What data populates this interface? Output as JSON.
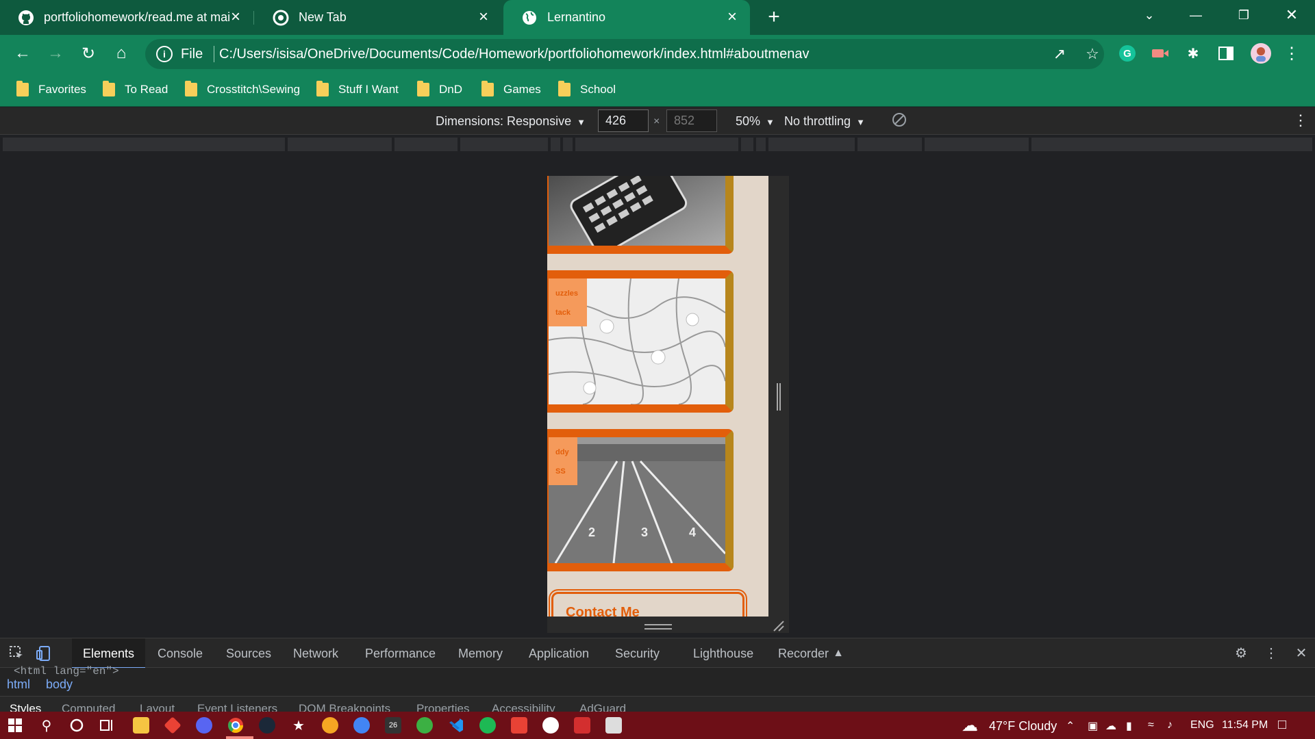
{
  "browser": {
    "tabs": [
      {
        "title": "portfoliohomework/read.me at mair",
        "icon": "github-icon"
      },
      {
        "title": "New Tab",
        "icon": "chrome-icon"
      },
      {
        "title": "Lernantino",
        "icon": "globe-icon",
        "active": true
      }
    ],
    "toolbar": {
      "scheme": "File",
      "url": "C:/Users/isisa/OneDrive/Documents/Code/Homework/portfoliohomework/index.html#aboutmenav"
    },
    "bookmarks": [
      "Favorites",
      "To Read",
      "Crosstitch\\Sewing",
      "Stuff I Want",
      "DnD",
      "Games",
      "School"
    ]
  },
  "device_toolbar": {
    "dimensions_label": "Dimensions: Responsive",
    "width": "426",
    "height": "852",
    "times": "×",
    "zoom": "50%",
    "throttling": "No throttling"
  },
  "page": {
    "cards": [
      {
        "name": "calculator",
        "tag_lines": []
      },
      {
        "name": "puzzles",
        "tag_lines": [
          "uzzles",
          "tack"
        ]
      },
      {
        "name": "track",
        "tag_lines": [
          "ddy",
          "SS"
        ]
      }
    ],
    "contact_heading": "Contact Me"
  },
  "devtools": {
    "tabs": [
      "Elements",
      "Console",
      "Sources",
      "Network",
      "Performance",
      "Memory",
      "Application",
      "Security",
      "Lighthouse",
      "Recorder"
    ],
    "active_tab": "Elements",
    "partial_code": "<html lang=\"en\">",
    "breadcrumbs": [
      "html",
      "body"
    ],
    "subtabs": [
      "Styles",
      "Computed",
      "Layout",
      "Event Listeners",
      "DOM Breakpoints",
      "Properties",
      "Accessibility",
      "AdGuard"
    ]
  },
  "taskbar": {
    "weather": "47°F  Cloudy",
    "lang": "ENG",
    "time": "11:54 PM"
  },
  "colors": {
    "accent_orange": "#e25e0b",
    "tag_orange": "#f59a5b",
    "page_bg": "#e2d6c9",
    "chrome_green": "#13845a",
    "taskbar_red": "#6d0f17"
  }
}
